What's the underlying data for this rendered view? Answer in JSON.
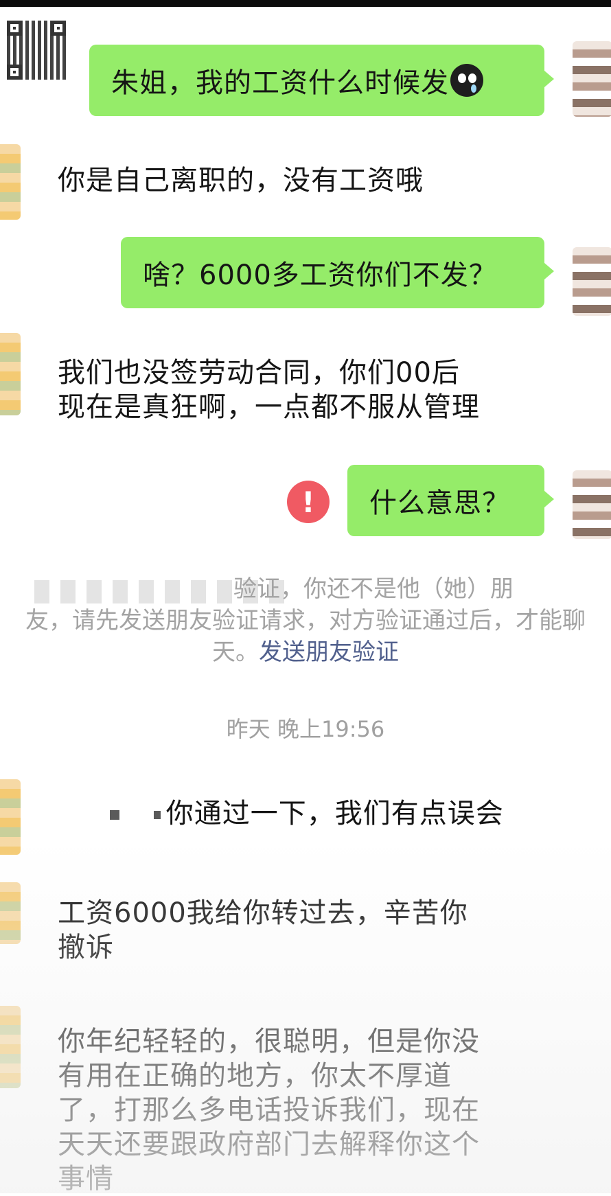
{
  "messages": {
    "m1": "朱姐，我的工资什么时候发",
    "m2": "你是自己离职的，没有工资哦",
    "m3": "啥？6000多工资你们不发？",
    "m4_l1": "我们也没签劳动合同，你们00后",
    "m4_l2": "现在是真狂啊，一点都不服从管理",
    "m5": "什么意思？",
    "m6": "你通过一下，我们有点误会",
    "m7_l1": "工资6000我给你转过去，辛苦你",
    "m7_l2": "撤诉",
    "m8_l1": "你年纪轻轻的，很聪明，但是你没",
    "m8_l2": "有用在正确的地方，你太不厚道",
    "m8_l3": "了，打那么多电话投诉我们，现在",
    "m8_l4": "天天还要跟政府部门去解释你这个",
    "m8_l5": "事情"
  },
  "system": {
    "line1": "验证，你还不是他（她）朋",
    "line2": "友，请先发送朋友验证请求，对方验证通过后，才能聊",
    "line3_prefix": "天。",
    "link": "发送朋友验证",
    "timestamp": "昨天 晚上19:56"
  },
  "icons": {
    "warning": "!",
    "emoji": "crying-face-icon",
    "qr": "qr-code-icon"
  },
  "colors": {
    "bubble": "#95ec69",
    "warning": "#f05a63",
    "link": "#51608d"
  }
}
